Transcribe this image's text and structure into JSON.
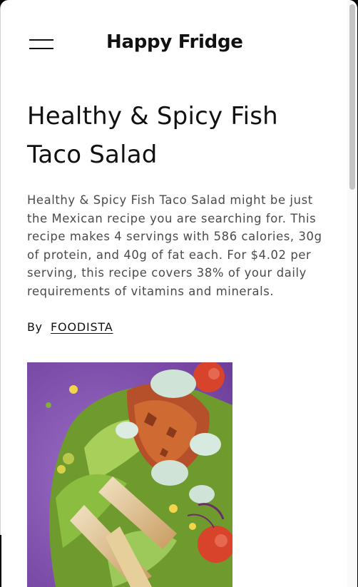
{
  "header": {
    "brand": "Happy Fridge",
    "menu_icon": "hamburger-menu-icon"
  },
  "recipe": {
    "title": "Healthy & Spicy Fish Taco Salad",
    "summary": "Healthy & Spicy Fish Taco Salad might be just the Mexican recipe you are searching for. This recipe makes 4 servings with 586 calories, 30g of protein, and 40g of fat each. For $4.02 per serving, this recipe covers 38% of your daily requirements of vitamins and minerals.",
    "by_label": "By",
    "author": "FOODISTA"
  },
  "colors": {
    "plate": "#8a5bb8",
    "greens": "#7fae3c",
    "tomato": "#d8432c",
    "dressing": "#cfe4d6"
  }
}
